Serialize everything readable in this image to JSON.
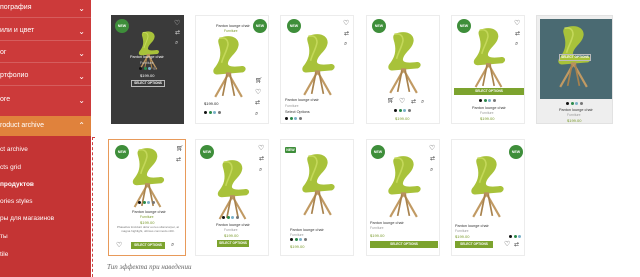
{
  "sidebar": {
    "items": [
      {
        "label": "пография"
      },
      {
        "label": "или и цвет"
      },
      {
        "label": "ог"
      },
      {
        "label": "ртфолио"
      },
      {
        "label": "ore"
      },
      {
        "label": "roduct archive"
      }
    ],
    "sub_items": [
      {
        "label": "ct archive"
      },
      {
        "label": "cts grid"
      },
      {
        "label": "продуктов"
      },
      {
        "label": "ories styles"
      },
      {
        "label": "ры для магазинов"
      },
      {
        "label": "ты"
      },
      {
        "label": "tile"
      }
    ]
  },
  "caption": "Тип эффекта при наведении",
  "products": [
    {
      "badge": "NEW",
      "name": "Panton lounge chair",
      "category": "Furniture",
      "price": "$199.00",
      "button": "SELECT OPTIONS"
    },
    {
      "badge": "NEW",
      "name": "Panton lounge chair",
      "category": "Furniture",
      "price": "$199.00"
    },
    {
      "badge": "NEW",
      "name": "Panton lounge chair",
      "category": "Furniture",
      "select": "Select Options"
    },
    {
      "badge": "NEW",
      "price": "$199.00"
    },
    {
      "badge": "NEW",
      "name": "Panton lounge chair",
      "category": "Furniture",
      "price": "$199.00",
      "button": "SELECT OPTIONS"
    },
    {
      "badge": "",
      "name": "Panton lounge chair",
      "category": "Furniture",
      "price": "$199.00",
      "button": "SELECT OPTIONS"
    },
    {
      "badge": "NEW",
      "name": "Panton lounge chair",
      "category": "Furniture",
      "price": "$199.00",
      "desc": "Phasellus tincidunt dolor eu leo ullamcorper, at magna highlight, ultrices commodo nibh.",
      "button": "SELECT OPTIONS"
    },
    {
      "badge": "NEW",
      "name": "Panton lounge chair",
      "category": "Furniture",
      "price": "$199.00",
      "button": "SELECT OPTIONS"
    },
    {
      "badge": "NEW",
      "name": "Panton lounge chair",
      "category": "Furniture",
      "price": "$199.00"
    },
    {
      "badge": "NEW",
      "name": "Panton lounge chair",
      "category": "Furniture",
      "price": "$199.00",
      "button": "SELECT OPTIONS"
    },
    {
      "badge": "NEW",
      "name": "Panton lounge chair",
      "category": "Furniture",
      "price": "$199.00",
      "button": "SELECT OPTIONS"
    }
  ],
  "colors": {
    "sidebar": "#cc3a3a",
    "active": "#e0823c",
    "accent": "#7ca32e",
    "badge": "#3e8e3a"
  }
}
